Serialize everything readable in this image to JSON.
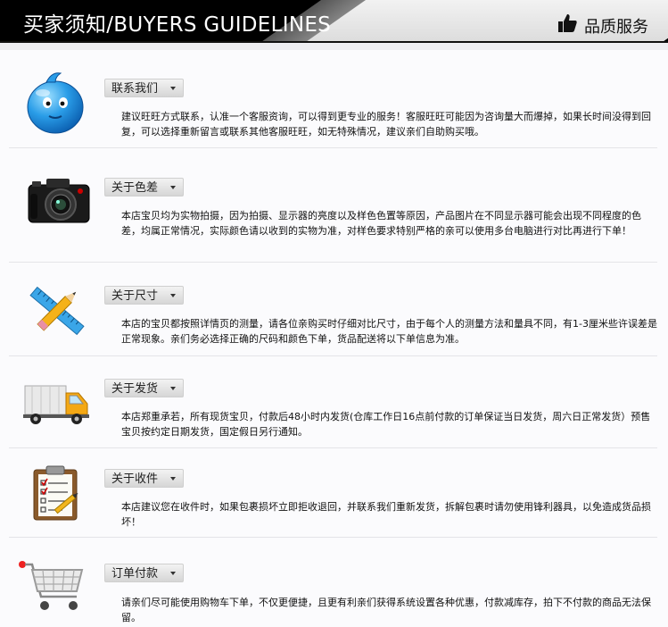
{
  "header": {
    "title": "买家须知/BUYERS GUIDELINES",
    "right_label": "品质服务"
  },
  "icons": {
    "wangwang": "wangwang-chat-icon",
    "camera": "camera-icon",
    "ruler": "pencil-ruler-icon",
    "truck": "truck-icon",
    "clipboard": "clipboard-icon",
    "cart": "shopping-cart-icon",
    "thumb": "thumbs-up-icon"
  },
  "sections": [
    {
      "label": "联系我们",
      "text": "建议旺旺方式联系，认准一个客服资询，可以得到更专业的服务！客服旺旺可能因为咨询量大而爆掉，如果长时间没得到回复，可以选择重新留言或联系其他客服旺旺，如无特殊情况，建议亲们自助购买哦。"
    },
    {
      "label": "关于色差",
      "text": "本店宝贝均为实物拍摄，因为拍摄、显示器的亮度以及样色色置等原因，产品图片在不同显示器可能会出现不同程度的色差，均属正常情况，实际颜色请以收到的实物为准，对样色要求特别严格的亲可以使用多台电脑进行对比再进行下单！"
    },
    {
      "label": "关于尺寸",
      "text": "本店的宝贝都按照详情页的测量，请各位亲购买时仔细对比尺寸，由于每个人的测量方法和量具不同，有1-3厘米些许误差是正常现象。亲们务必选择正确的尺码和颜色下单，货品配送将以下单信息为准。"
    },
    {
      "label": "关于发货",
      "text": "本店郑重承若，所有现货宝贝，付款后48小时内发货(仓库工作日16点前付款的订单保证当日发货，周六日正常发货）预售宝贝按约定日期发货，国定假日另行通知。"
    },
    {
      "label": "关于收件",
      "text": "本店建议您在收件时，如果包裹损坏立即拒收退回，并联系我们重新发货，拆解包裹时请勿使用锋利器具，以免造成货品损坏！"
    },
    {
      "label": "订单付款",
      "text": "请亲们尽可能使用购物车下单，不仅更便捷，且更有利亲们获得系统设置各种优惠，付款减库存，拍下不付款的商品无法保留。"
    }
  ]
}
